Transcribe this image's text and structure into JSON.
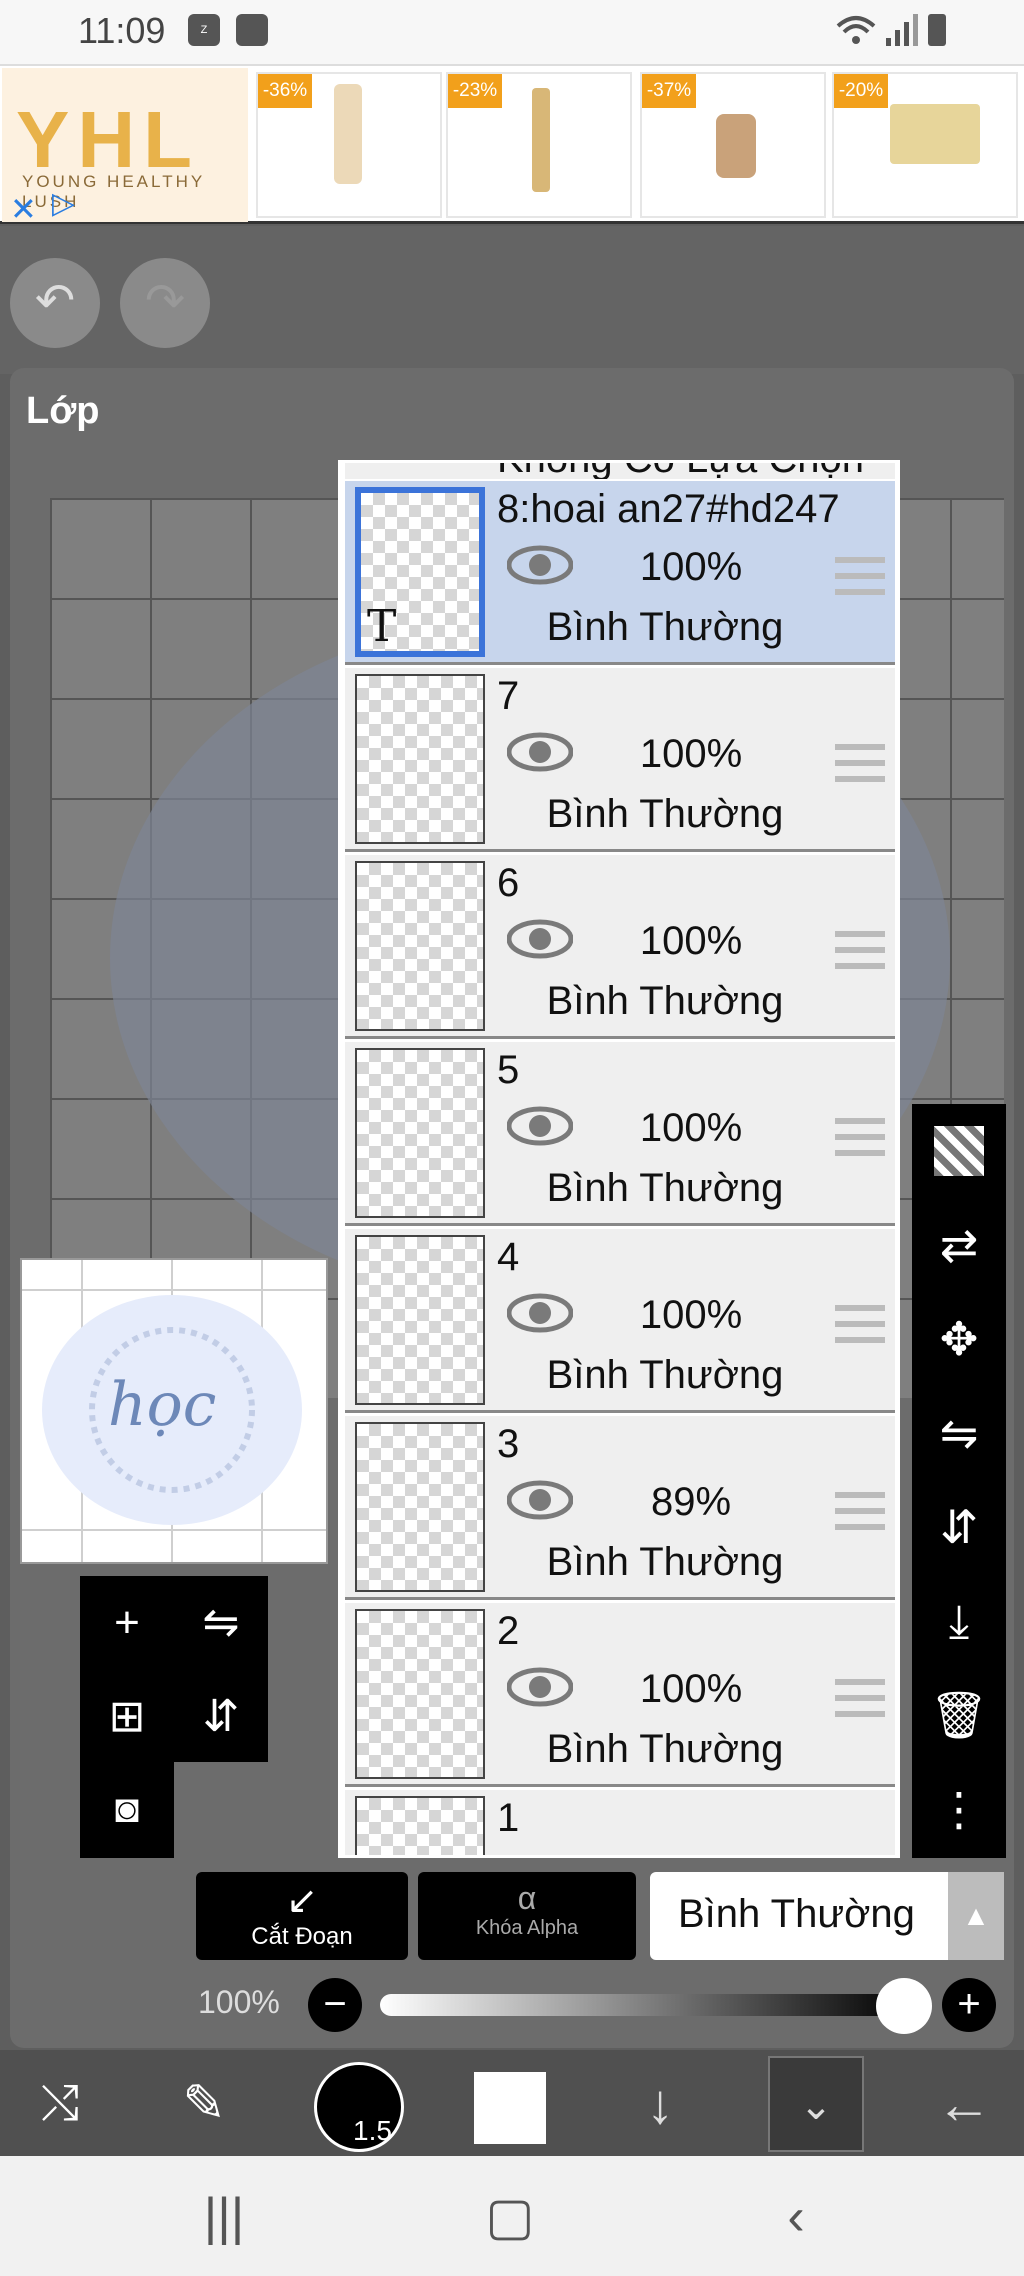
{
  "status_bar": {
    "time": "11:09",
    "icons": [
      "zalo-icon",
      "clock-icon",
      "wifi-icon",
      "signal-icon",
      "battery-icon"
    ]
  },
  "ad": {
    "brand": "YHL",
    "tagline": "YOUNG HEALTHY LUSH",
    "items": [
      {
        "discount": "-36%"
      },
      {
        "discount": "-23%"
      },
      {
        "discount": "-37%"
      },
      {
        "discount": "-20%"
      }
    ]
  },
  "panel": {
    "title": "Lớp"
  },
  "layers": {
    "partial_top_label": "Không Có Lựa Chọn",
    "items": [
      {
        "name": "8:hoai an27#hd247",
        "opacity": "100%",
        "mode": "Bình Thường",
        "active": true
      },
      {
        "name": "7",
        "opacity": "100%",
        "mode": "Bình Thường",
        "active": false
      },
      {
        "name": "6",
        "opacity": "100%",
        "mode": "Bình Thường",
        "active": false
      },
      {
        "name": "5",
        "opacity": "100%",
        "mode": "Bình Thường",
        "active": false
      },
      {
        "name": "4",
        "opacity": "100%",
        "mode": "Bình Thường",
        "active": false
      },
      {
        "name": "3",
        "opacity": "89%",
        "mode": "Bình Thường",
        "active": false
      },
      {
        "name": "2",
        "opacity": "100%",
        "mode": "Bình Thường",
        "active": false
      },
      {
        "name": "1",
        "opacity": "",
        "mode": "",
        "active": false
      }
    ]
  },
  "bottom_controls": {
    "clip_label": "Cắt Đoạn",
    "alpha_lock_label": "Khóa Alpha",
    "blend_mode": "Bình Thường",
    "opacity_label": "100%"
  },
  "preview": {
    "text": "học"
  },
  "brush": {
    "size": "1.5"
  }
}
